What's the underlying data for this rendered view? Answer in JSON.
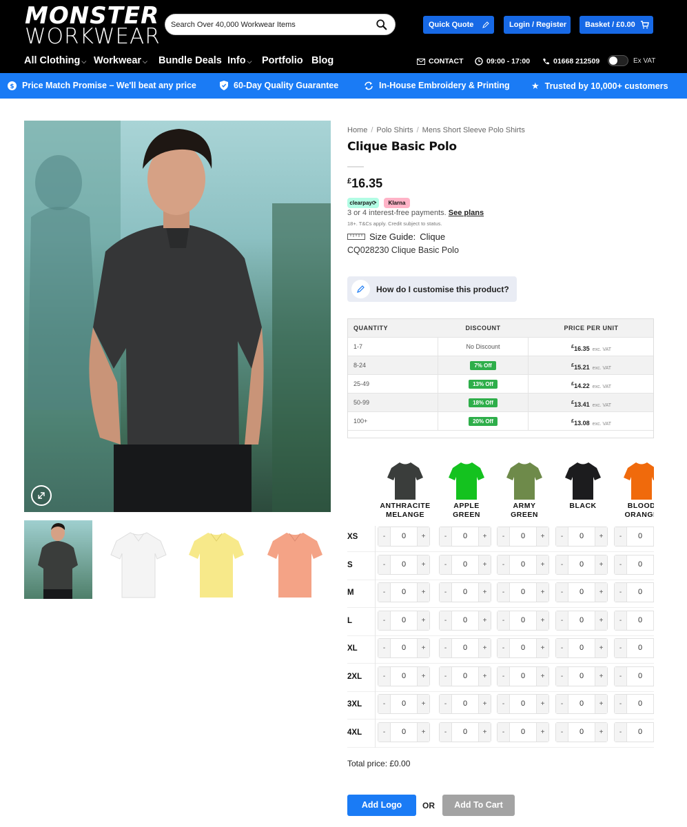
{
  "header": {
    "logo_top": "MONSTER",
    "logo_bottom": "WORKWEAR",
    "search_placeholder": "Search Over 40,000 Workwear Items",
    "quick_quote": "Quick Quote",
    "login": "Login / Register",
    "basket": "Basket / £0.00"
  },
  "nav": {
    "items": [
      "All Clothing",
      "Workwear",
      "Bundle Deals",
      "Info",
      "Portfolio",
      "Blog"
    ],
    "contact": "CONTACT",
    "hours": "09:00 - 17:00",
    "phone": "01668 212509",
    "vat_toggle": "Ex VAT"
  },
  "promo": [
    "Price Match Promise – We'll beat any price",
    "60-Day Quality Guarantee",
    "In-House Embroidery & Printing",
    "Trusted by 10,000+ customers"
  ],
  "breadcrumb": [
    "Home",
    "Polo Shirts",
    "Mens Short Sleeve Polo Shirts"
  ],
  "product": {
    "title": "Clique Basic Polo",
    "price_symbol": "£",
    "price": "16.35",
    "clearpay": "clearpay⟳",
    "klarna": "Klarna",
    "bnpl_text": "3 or 4 interest-free payments.",
    "bnpl_link": "See plans",
    "fine_print": "18+. T&Cs apply. Credit subject to status.",
    "size_guide_label": "Size Guide:",
    "size_guide_brand": "Clique",
    "sku": "CQ028230 Clique Basic Polo",
    "customise": "How do I customise this product?"
  },
  "quantity_table": {
    "headers": [
      "QUANTITY",
      "DISCOUNT",
      "PRICE PER UNIT"
    ],
    "rows": [
      {
        "qty": "1-7",
        "discount": "No Discount",
        "price": "16.35"
      },
      {
        "qty": "8-24",
        "discount": "7% Off",
        "price": "15.21"
      },
      {
        "qty": "25-49",
        "discount": "13% Off",
        "price": "14.22"
      },
      {
        "qty": "50-99",
        "discount": "18% Off",
        "price": "13.41"
      },
      {
        "qty": "100+",
        "discount": "20% Off",
        "price": "13.08"
      }
    ],
    "currency": "£",
    "vat_note": "exc. VAT"
  },
  "colours": [
    {
      "name1": "ANTHRACITE",
      "name2": "MELANGE",
      "color": "#3a3d3b"
    },
    {
      "name1": "APPLE",
      "name2": "GREEN",
      "color": "#14c21f"
    },
    {
      "name1": "ARMY",
      "name2": "GREEN",
      "color": "#6e8a4a"
    },
    {
      "name1": "BLACK",
      "name2": "",
      "color": "#1c1c1e"
    },
    {
      "name1": "BLOOD",
      "name2": "ORANGE",
      "color": "#f06a0c"
    }
  ],
  "sizes": [
    "XS",
    "S",
    "M",
    "L",
    "XL",
    "2XL",
    "3XL",
    "4XL"
  ],
  "stepper": {
    "minus": "-",
    "plus": "+",
    "value": "0"
  },
  "total_label": "Total price:",
  "total_value": "£0.00",
  "add_logo": "Add Logo",
  "or": "OR",
  "add_to_cart": "Add To Cart",
  "thumbnail_colors": [
    "#3a3d3b",
    "#f4f4f4",
    "#f7e98a",
    "#f4a386"
  ]
}
